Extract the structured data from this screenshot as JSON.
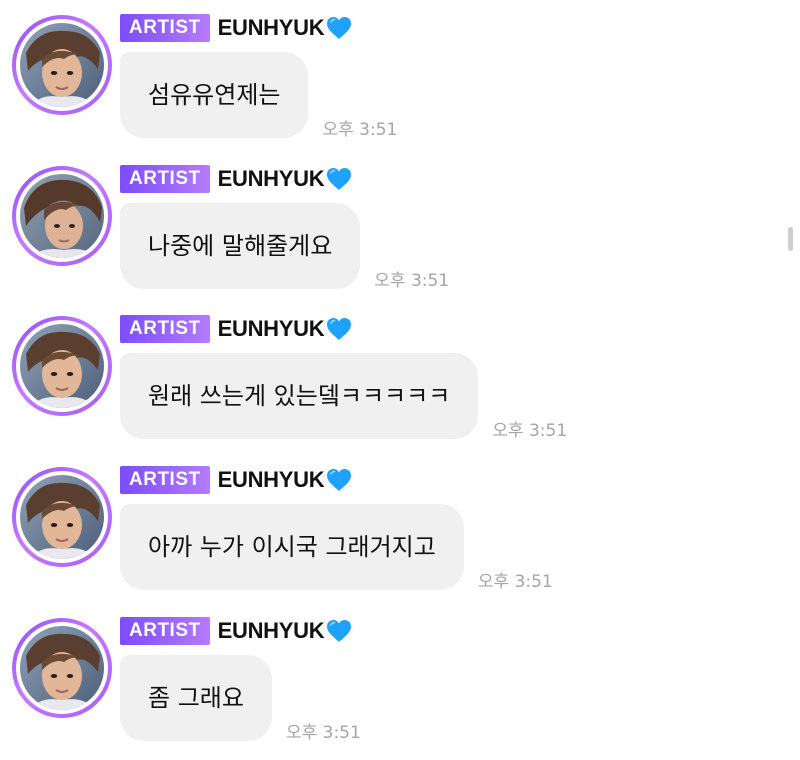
{
  "messages": [
    {
      "badge": "ARTIST",
      "name": "EUNHYUK",
      "text": "섬유유연제는",
      "time": "오후 3:51"
    },
    {
      "badge": "ARTIST",
      "name": "EUNHYUK",
      "text": "나중에 말해줄게요",
      "time": "오후 3:51"
    },
    {
      "badge": "ARTIST",
      "name": "EUNHYUK",
      "text": "원래 쓰는게 있는뎈ㅋㅋㅋㅋㅋ",
      "time": "오후 3:51"
    },
    {
      "badge": "ARTIST",
      "name": "EUNHYUK",
      "text": "아까 누가 이시국 그래거지고",
      "time": "오후 3:51"
    },
    {
      "badge": "ARTIST",
      "name": "EUNHYUK",
      "text": "좀 그래요",
      "time": "오후 3:51"
    }
  ],
  "icons": {
    "heart": "blue-heart-icon",
    "avatar": "artist-avatar"
  },
  "colors": {
    "badge_start": "#7b4dff",
    "badge_end": "#b57bff",
    "heart": "#1fa2ff",
    "bubble": "#f0f0f0",
    "time": "#a5a5a5"
  }
}
